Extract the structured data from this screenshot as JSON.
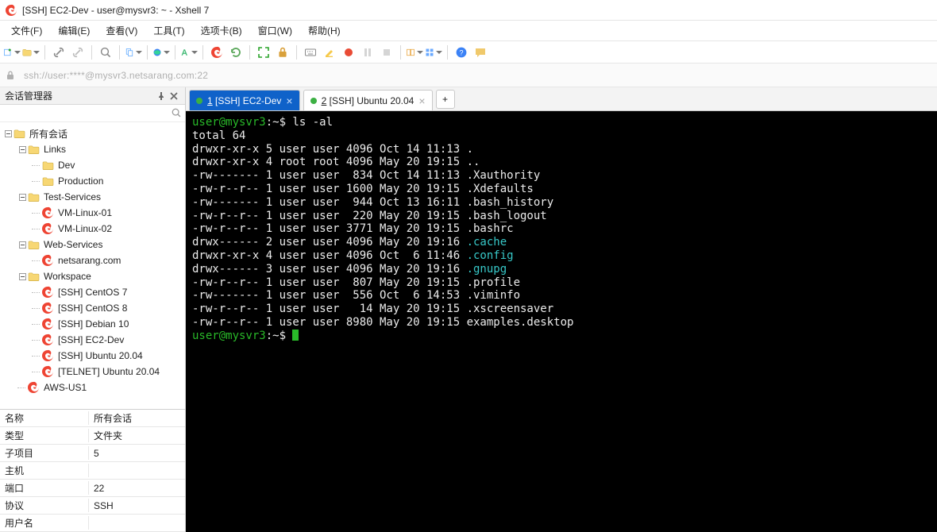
{
  "title": "[SSH] EC2-Dev - user@mysvr3: ~ - Xshell 7",
  "menu": [
    "文件(F)",
    "编辑(E)",
    "查看(V)",
    "工具(T)",
    "选项卡(B)",
    "窗口(W)",
    "帮助(H)"
  ],
  "address": "ssh://user:****@mysvr3.netsarang.com:22",
  "panel": {
    "title": "会话管理器",
    "search_placeholder": "",
    "tree": {
      "root": "所有会话",
      "links": {
        "label": "Links",
        "children": [
          "Dev",
          "Production"
        ]
      },
      "test": {
        "label": "Test-Services",
        "children": [
          "VM-Linux-01",
          "VM-Linux-02"
        ]
      },
      "web": {
        "label": "Web-Services",
        "children": [
          "netsarang.com"
        ]
      },
      "workspace": {
        "label": "Workspace",
        "children": [
          "[SSH] CentOS 7",
          "[SSH] CentOS 8",
          "[SSH] Debian 10",
          "[SSH] EC2-Dev",
          "[SSH] Ubuntu 20.04",
          "[TELNET] Ubuntu 20.04"
        ]
      },
      "aws": "AWS-US1"
    },
    "props": {
      "labels": {
        "name": "名称",
        "type": "类型",
        "children": "子项目",
        "host": "主机",
        "port": "端口",
        "protocol": "协议",
        "user": "用户名"
      },
      "values": {
        "name": "所有会话",
        "type": "文件夹",
        "children": "5",
        "host": "",
        "port": "22",
        "protocol": "SSH",
        "user": ""
      }
    }
  },
  "tabs": {
    "active": {
      "num": "1",
      "label": "[SSH] EC2-Dev"
    },
    "second": {
      "num": "2",
      "label": "[SSH] Ubuntu 20.04"
    },
    "add": "+"
  },
  "terminal": {
    "prompt_user": "user@mysvr3",
    "prompt_tail": ":~$ ",
    "cmd": "ls -al",
    "lines": [
      "total 64",
      "drwxr-xr-x 5 user user 4096 Oct 14 11:13 .",
      "drwxr-xr-x 4 root root 4096 May 20 19:15 ..",
      "-rw------- 1 user user  834 Oct 14 11:13 .Xauthority",
      "-rw-r--r-- 1 user user 1600 May 20 19:15 .Xdefaults",
      "-rw------- 1 user user  944 Oct 13 16:11 .bash_history",
      "-rw-r--r-- 1 user user  220 May 20 19:15 .bash_logout",
      "-rw-r--r-- 1 user user 3771 May 20 19:15 .bashrc"
    ],
    "dir1": {
      "pre": "drwx------ 2 user user 4096 May 20 19:16 ",
      "name": ".cache"
    },
    "dir2": {
      "pre": "drwxr-xr-x 4 user user 4096 Oct  6 11:46 ",
      "name": ".config"
    },
    "dir3": {
      "pre": "drwx------ 3 user user 4096 May 20 19:16 ",
      "name": ".gnupg"
    },
    "lines2": [
      "-rw-r--r-- 1 user user  807 May 20 19:15 .profile",
      "-rw------- 1 user user  556 Oct  6 14:53 .viminfo",
      "-rw-r--r-- 1 user user   14 May 20 19:15 .xscreensaver",
      "-rw-r--r-- 1 user user 8980 May 20 19:15 examples.desktop"
    ]
  }
}
